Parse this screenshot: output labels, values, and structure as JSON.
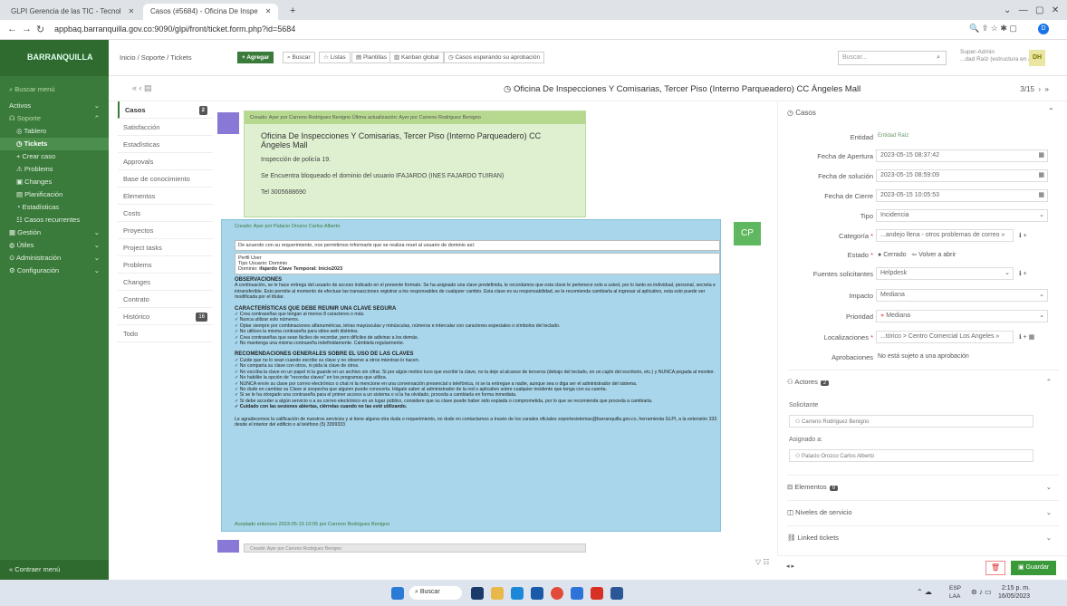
{
  "browser": {
    "tab1": "GLPI Gerencia de las TIC - Tecnol",
    "tab2": "Casos (#5684) - Oficina De Inspe",
    "url": "appbaq.barranquilla.gov.co:9090/glpi/front/ticket.form.php?id=5684"
  },
  "sidebar": {
    "logo": "BARRANQUILLA",
    "items": [
      {
        "label": "Buscar menú"
      },
      {
        "label": "Activos"
      },
      {
        "label": "Soporte"
      },
      {
        "label": "Tablero"
      },
      {
        "label": "Tickets"
      },
      {
        "label": "+  Crear caso"
      },
      {
        "label": "Problems"
      },
      {
        "label": "Changes"
      },
      {
        "label": "Planificación"
      },
      {
        "label": "Estadísticas"
      },
      {
        "label": "Casos recurrentes"
      },
      {
        "label": "Gestión"
      },
      {
        "label": "Útiles"
      },
      {
        "label": "Administración"
      },
      {
        "label": "Configuración"
      }
    ],
    "collapse": "Contraer menú"
  },
  "topbar": {
    "breadcrumb": "Inicio / Soporte / Tickets",
    "add": "+ Agregar",
    "buscar": "Buscar",
    "listas": "Listas",
    "plantillas": "Plantillas",
    "kanban": "Kanban global",
    "esperando": "Casos esperando su aprobación",
    "search_placeholder": "Buscar...",
    "user_role": "Super-Admin",
    "user_entity": "...dad Raíz (estructura en árbol)",
    "user_initials": "DH"
  },
  "ticket": {
    "title": "Oficina De Inspecciones Y Comisarias, Tercer Piso (Interno Parqueadero) CC Ángeles Mall",
    "pager": "3/15"
  },
  "left_tabs": [
    {
      "label": "Casos",
      "count": "2"
    },
    {
      "label": "Satisfacción"
    },
    {
      "label": "Estadísticas"
    },
    {
      "label": "Approvals"
    },
    {
      "label": "Base de conocimiento"
    },
    {
      "label": "Elementos"
    },
    {
      "label": "Costs"
    },
    {
      "label": "Proyectos"
    },
    {
      "label": "Project tasks"
    },
    {
      "label": "Problems"
    },
    {
      "label": "Changes"
    },
    {
      "label": "Contrato"
    },
    {
      "label": "Histórico",
      "count": "16"
    },
    {
      "label": "Todo"
    }
  ],
  "description": {
    "meta": "Creado: Ayer por  Carreno Rodriguez Benigno   Última actualización: Ayer por  Carreno Rodriguez Benigno",
    "subject": "Oficina De Inspecciones Y Comisarias, Tercer Piso (Interno Parqueadero) CC Ángeles Mall",
    "l1": "Inspección de policía 19.",
    "l2": "Se Encuentra bloqueado el dominio del usuario IFAJARDO (INES FAJARDO TUIRAN)",
    "l3": "Tel 3005688690"
  },
  "solution": {
    "meta": "Creado: Ayer por  Palacio Orozco Carlos Alberto",
    "badge": "CP",
    "intro": "De acuerdo con su requerimiento, nos permitimos informarle que se realiza reset al usuario de dominio así:",
    "p1": "Perfil User",
    "p2": "Tipo Usuario: Dominio",
    "p3a": "Dominio: ",
    "p3b": "ifajardo Clave Temporal: Inicio2023",
    "obs_h": "OBSERVACIONES",
    "obs": "A continuación, se le hace entrega del usuario de acceso indicado en el presente formato.  Se ha asignado una clave predefinida, le recordamos que esta clave le pertenece solo a usted, por lo tanto es individual, personal, secreta e intransferible.  Esto permite al momento de efectuar las transacciones registrar a los responsables de cualquier cambio.  Esta clave es su responsabilidad, se le recomienda cambiarla al ingresar al aplicativo, esta solo puede ser modificada por el titular.",
    "car_h": "CARACTERÍSTICAS QUE DEBE REUNIR UNA CLAVE SEGURA",
    "c1": "✓ Crea contraseñas que tengan al menos 8 caracteres o más.",
    "c2": "✓ Nunca utilizar solo números.",
    "c3": "✓ Optar siempre por combinaciones alfanuméricas, letras mayúsculas y minúsculas, números e intercalar con caracteres especiales o símbolos del teclado.",
    "c4": "✓ No utilices la misma contraseña para sitios web distintos.",
    "c5": "✓ Crea contraseñas que sean fáciles de recordar, pero difíciles de adivinar a los demás.",
    "c6": "✓ No mantenga una misma contraseña indefinidamente.  Cámbiela regularmente.",
    "rec_h": "RECOMENDACIONES GENERALES SOBRE EL USO DE LAS CLAVES",
    "r1": "✓ Cuide que no lo vean cuando escribe su clave y no observe a otros mientras lo hacen.",
    "r2": "✓ No comparta su clave con otros, ni pida la clave de otros.",
    "r3": "✓ No escriba la clave en un papel ni la guarde en un archivo sin cifrar.  Si por algún motivo tuvo que escribir la clave, no la deje al alcance de terceros (debajo del teclado, en un cajón del escritorio, etc.) y NUNCA pegada al monitor.",
    "r4": "✓ No habilite la opción de \"recordar claves\" en los programas que utiliza.",
    "r5": "✓ NUNCA envíe su clave por correo electrónico o chat ni la mencione en una conversación presencial o telefónica, ni se la entregue a nadie, aunque sea o diga ser el administrador del sistema.",
    "r6": "✓ No dude en cambiar su Clave si sospecha que alguien puede conocerla. Hágale saber al administrador de la red o aplicativo sobre cualquier incidente que tenga con su cuenta.",
    "r7": "✓ Si se le ha otorgado una contraseña para el primer acceso a un sistema o si la ha olvidado, proceda a cambiarla en forma inmediata.",
    "r8": "✓ Si debe acceder a algún servicio o a su correo electrónico en un lugar público, considere que su clave puede haber sido espiada o comprometida, por lo que se recomienda que proceda a cambiarla.",
    "r9": "✓ Cuidado con las sesiones abiertas, ciérrelas cuando no las esté utilizando.",
    "thanks": "Le agradecemos la calificación de nuestros servicios y si tiene alguna otra duda o requerimiento, no dude en contactarnos a través de los canales oficiales soportesistemas@barranquilla.gov.co, herramienta GLPI, a la extensión 333 desde el interior del edificio o al teléfono (5) 3399333",
    "accepted": "Aceptado entonces 2023-05-15 10:05 por Carreno Rodriguez Benigno"
  },
  "next_item": "Creado: Ayer por  Carreno Rodriguez Benigno",
  "right": {
    "section": "Casos",
    "entidad_lbl": "Entidad",
    "entidad": "Entidad Raíz",
    "apertura_lbl": "Fecha de Apertura",
    "apertura": "2023-05-15 08:37:42",
    "solucion_lbl": "Fecha de solución",
    "solucion": "2023-05-15 08:59:09",
    "cierre_lbl": "Fecha de Cierre",
    "cierre": "2023-05-15 10:05:53",
    "tipo_lbl": "Tipo",
    "tipo": "Incidencia",
    "categoria_lbl": "Categoría",
    "categoria": "...andejo llena - otros problemas de correo »",
    "estado_lbl": "Estado",
    "estado": "Cerrado",
    "reabrir": "Volver a abrir",
    "fuentes_lbl": "Fuentes solicitantes",
    "fuentes": "Helpdesk",
    "impacto_lbl": "Impacto",
    "impacto": "Mediana",
    "prioridad_lbl": "Prioridad",
    "prioridad": "Mediana",
    "local_lbl": "Localizaciones",
    "local": "...tórico > Centro Comercial Los Angeles »",
    "aprob_lbl": "Aprobaciones",
    "aprob": "No está sujeto a una aprobación",
    "actores": "Actores",
    "actores_count": "2",
    "solicitante_lbl": "Solicitante",
    "solicitante": "Carreno Rodriguez Benigno",
    "asignado_lbl": "Asignado a:",
    "asignado": "Palacio Orozco Carlos Alberto",
    "elementos": "Elementos",
    "elementos_count": "0",
    "niveles": "Niveles de servicio",
    "linked": "Linked tickets",
    "guardar": "Guardar"
  },
  "taskbar": {
    "search": "Buscar",
    "lang1": "ESP",
    "lang2": "LAA",
    "time": "2:15 p. m.",
    "date": "16/05/2023"
  }
}
